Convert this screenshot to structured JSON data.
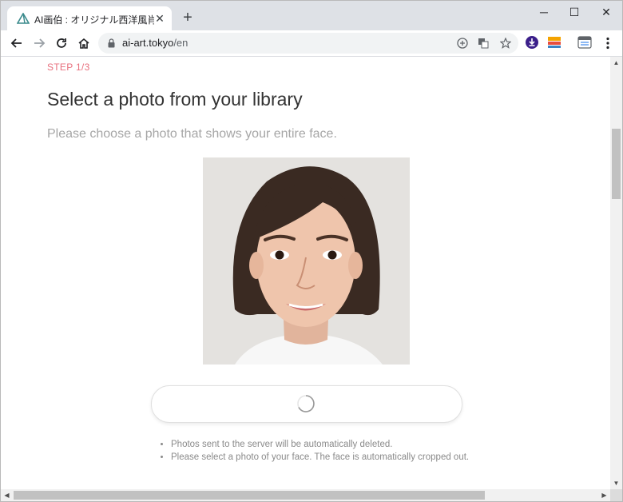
{
  "browser": {
    "tab_title": "AI画伯 : オリジナル西洋風肖像画",
    "tab_close": "✕",
    "new_tab": "+",
    "window_controls": {
      "minimize": "─",
      "maximize": "☐",
      "close": "✕"
    },
    "url_host": "ai-art.tokyo",
    "url_path": "/en",
    "toolbar_icons": [
      "back-icon",
      "forward-icon",
      "reload-icon",
      "home-icon",
      "lock-icon",
      "add-icon",
      "translate-icon",
      "star-icon",
      "download-extension-icon",
      "smart-extension-icon",
      "calendar-extension-icon",
      "menu-icon"
    ]
  },
  "page": {
    "step_label": "STEP 1/3",
    "heading": "Select a photo from your library",
    "subheading": "Please choose a photo that shows your entire face.",
    "notes": [
      "Photos sent to the server will be automatically deleted.",
      "Please select a photo of your face. The face is automatically cropped out."
    ]
  },
  "colors": {
    "accent": "#e8707e",
    "tab_strip": "#dee1e6",
    "omnibox": "#f1f3f4"
  }
}
